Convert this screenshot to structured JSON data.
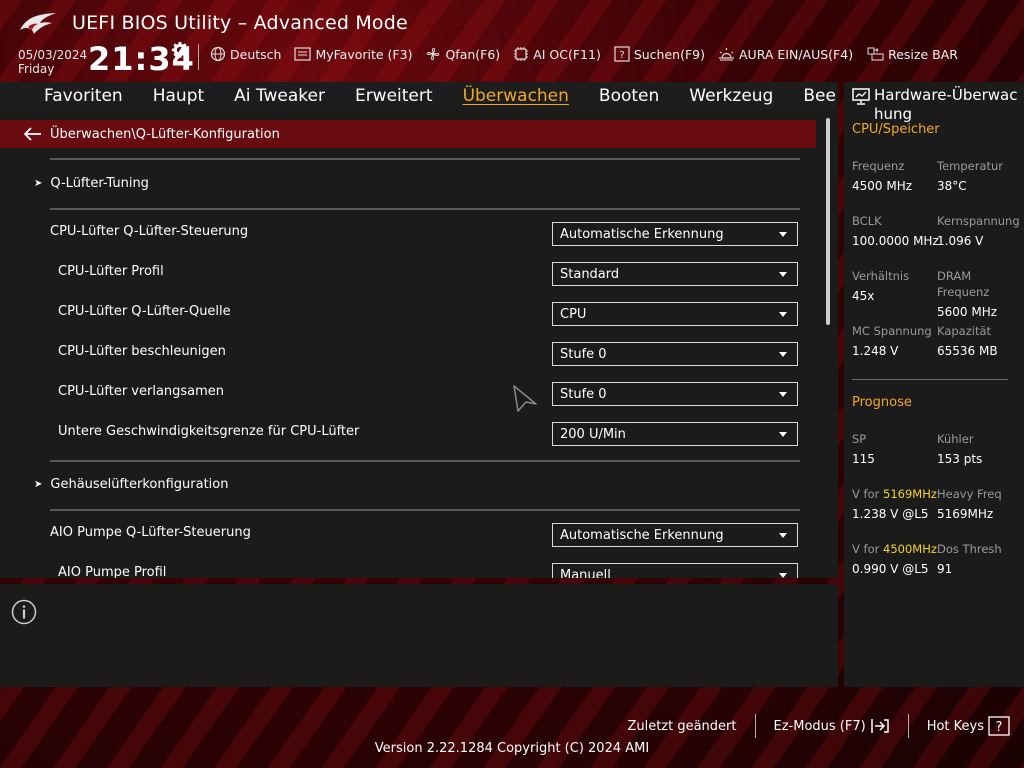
{
  "header": {
    "title": "UEFI BIOS Utility – Advanced Mode",
    "date": "05/03/2024",
    "day": "Friday",
    "time": "21:34",
    "items": [
      {
        "label": "Deutsch",
        "icon": "globe-icon"
      },
      {
        "label": "MyFavorite (F3)",
        "icon": "favorite-list-icon"
      },
      {
        "label": "Qfan(F6)",
        "icon": "fan-icon"
      },
      {
        "label": "AI OC(F11)",
        "icon": "ai-chip-icon"
      },
      {
        "label": "Suchen(F9)",
        "icon": "help-search-icon"
      },
      {
        "label": "AURA EIN/AUS(F4)",
        "icon": "aura-light-icon"
      },
      {
        "label": "Resize BAR",
        "icon": "resize-bar-icon"
      }
    ]
  },
  "tabs": [
    "Favoriten",
    "Haupt",
    "Ai Tweaker",
    "Erweitert",
    "Überwachen",
    "Booten",
    "Werkzeug",
    "Beenden"
  ],
  "active_tab": "Überwachen",
  "breadcrumb": "Überwachen\\Q-Lüfter-Konfiguration",
  "settings": {
    "submenu_tuning": "Q-Lüfter-Tuning",
    "cpu_control": {
      "label": "CPU-Lüfter Q-Lüfter-Steuerung",
      "value": "Automatische Erkennung"
    },
    "cpu_profile": {
      "label": "CPU-Lüfter Profil",
      "value": "Standard"
    },
    "cpu_source": {
      "label": "CPU-Lüfter Q-Lüfter-Quelle",
      "value": "CPU"
    },
    "cpu_accel": {
      "label": "CPU-Lüfter beschleunigen",
      "value": "Stufe 0"
    },
    "cpu_decel": {
      "label": "CPU-Lüfter verlangsamen",
      "value": "Stufe 0"
    },
    "cpu_lower_limit": {
      "label": "Untere Geschwindigkeitsgrenze für CPU-Lüfter",
      "value": "200 U/Min"
    },
    "submenu_chassis": "Gehäuselüfterkonfiguration",
    "aio_control": {
      "label": "AIO Pumpe Q-Lüfter-Steuerung",
      "value": "Automatische Erkennung"
    },
    "aio_profile": {
      "label": "AIO Pumpe Profil",
      "value": "Manuell"
    }
  },
  "hw_monitor": {
    "title": "Hardware-Überwachung",
    "cpu_section": "CPU/Speicher",
    "frequency": {
      "label": "Frequenz",
      "value": "4500 MHz"
    },
    "temperature": {
      "label": "Temperatur",
      "value": "38°C"
    },
    "bclk": {
      "label": "BCLK",
      "value": "100.0000 MHz"
    },
    "core_voltage": {
      "label": "Kernspannung",
      "value": "1.096 V"
    },
    "ratio": {
      "label": "Verhältnis",
      "value": "45x"
    },
    "dram_freq": {
      "label": "DRAM Frequenz",
      "value": "5600 MHz"
    },
    "mc_voltage": {
      "label": "MC Spannung",
      "value": "1.248 V"
    },
    "capacity": {
      "label": "Kapazität",
      "value": "65536 MB"
    },
    "prognosis_section": "Prognose",
    "sp": {
      "label": "SP",
      "value": "115"
    },
    "cooler": {
      "label": "Kühler",
      "value": "153 pts"
    },
    "v_for_1": {
      "label_prefix": "V for ",
      "label_freq": "5169MHz",
      "value": "1.238 V @L5"
    },
    "heavy_freq": {
      "label": "Heavy Freq",
      "value": "5169MHz"
    },
    "v_for_2": {
      "label_prefix": "V for ",
      "label_freq": "4500MHz",
      "value": "0.990 V @L5"
    },
    "dos_thresh": {
      "label": "Dos Thresh",
      "value": "91"
    }
  },
  "footer": {
    "last_changed": "Zuletzt geändert",
    "ez_mode": "Ez-Modus (F7)",
    "hot_keys": "Hot Keys",
    "version": "Version 2.22.1284 Copyright (C) 2024 AMI"
  },
  "colors": {
    "accent": "#f2a92a",
    "highlight": "#f2d32a",
    "breadcrumb_bg": "#6a0b0f",
    "panel_bg": "#1b1b1b"
  }
}
